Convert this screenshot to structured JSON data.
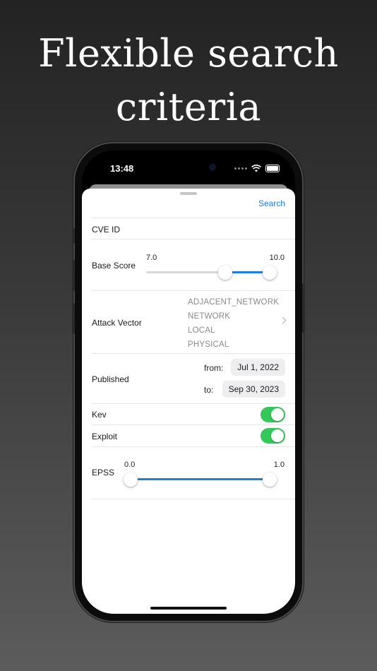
{
  "headline": {
    "line1": "Flexible search",
    "line2": "criteria"
  },
  "status_bar": {
    "time": "13:48"
  },
  "nav": {
    "search_label": "Search"
  },
  "form": {
    "cve_id": {
      "label": "CVE ID"
    },
    "base_score": {
      "label": "Base Score",
      "min_value": "7.0",
      "max_value": "10.0",
      "range": [
        7.0,
        10.0
      ],
      "scale": [
        0.0,
        10.0
      ]
    },
    "attack_vector": {
      "label": "Attack Vector",
      "options": [
        "ADJACENT_NETWORK",
        "NETWORK",
        "LOCAL",
        "PHYSICAL"
      ]
    },
    "published": {
      "label": "Published",
      "from_label": "from:",
      "from_value": "Jul 1, 2022",
      "to_label": "to:",
      "to_value": "Sep 30, 2023"
    },
    "kev": {
      "label": "Kev",
      "enabled": true
    },
    "exploit": {
      "label": "Exploit",
      "enabled": true
    },
    "epss": {
      "label": "EPSS",
      "min_value": "0.0",
      "max_value": "1.0",
      "range": [
        0.0,
        1.0
      ],
      "scale": [
        0.0,
        1.0
      ]
    }
  },
  "colors": {
    "accent": "#1e7de0",
    "toggle_on": "#34c759",
    "background_top": "#232323",
    "background_bottom": "#5c5c5c"
  }
}
